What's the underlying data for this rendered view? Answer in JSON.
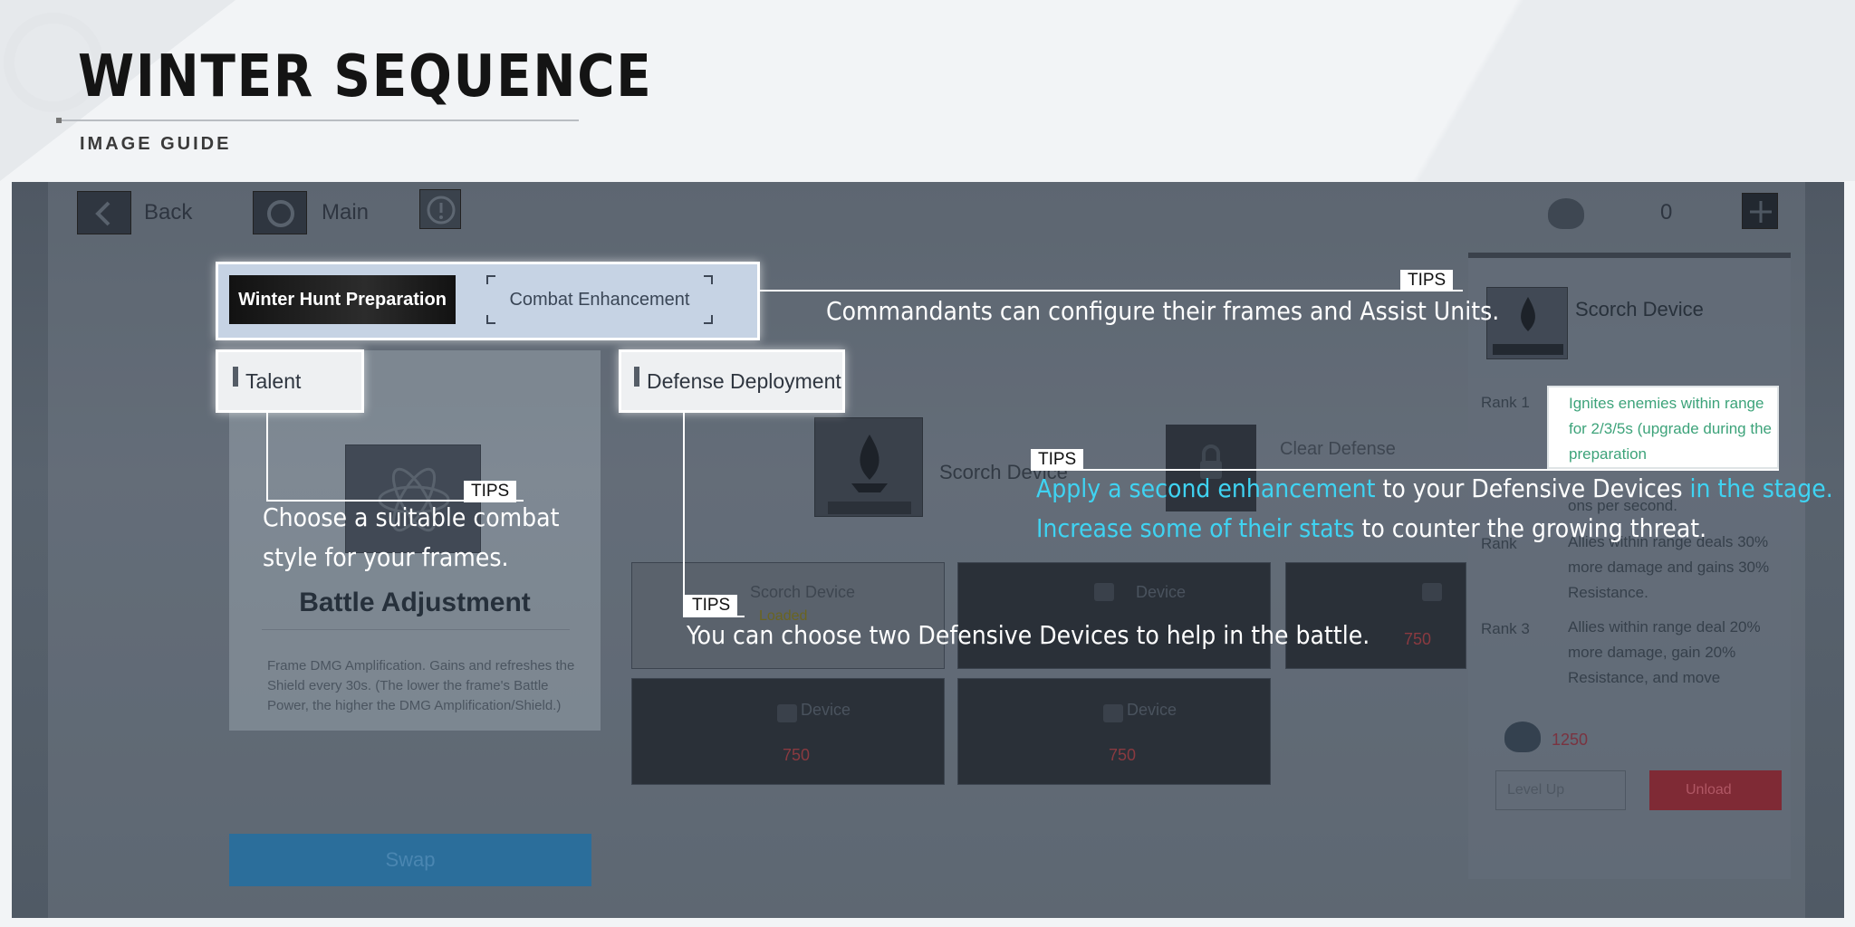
{
  "header": {
    "title": "WINTER SEQUENCE",
    "subtitle": "IMAGE GUIDE"
  },
  "topbar": {
    "back_label": "Back",
    "main_label": "Main",
    "currency_value": "0"
  },
  "tabs": {
    "active": "Winter Hunt Preparation",
    "inactive": "Combat Enhancement"
  },
  "sections": {
    "talent": "Talent",
    "defense": "Defense Deployment"
  },
  "talent_panel": {
    "title": "Battle Adjustment",
    "description": "Frame DMG Amplification. Gains and refreshes the Shield every 30s. (The lower the frame's Battle Power, the higher the DMG Amplification/Shield.)",
    "swap_label": "Swap"
  },
  "defense_center": {
    "selected_name": "Scorch Device",
    "rank_label": "Rank",
    "rank_value": "1",
    "clear_label": "Clear Defense"
  },
  "devices": [
    {
      "name": "Scorch Device",
      "status": "Loaded",
      "cost": ""
    },
    {
      "name": "Device",
      "status": "",
      "cost": ""
    },
    {
      "name": "Device",
      "status": "",
      "cost": "750"
    },
    {
      "name": "Device",
      "status": "",
      "cost": "750"
    },
    {
      "name": "Device",
      "status": "",
      "cost": "750"
    }
  ],
  "right_panel": {
    "title": "Scorch Device",
    "rank_badge": "1",
    "rank1_label": "Rank 1",
    "rank1_text": "Ignites enemies within range for 2/3/5s (upgrade during the preparation",
    "rank1_tail": "ons per second.",
    "rank2_label": "Rank",
    "rank2_text": "Allies within range deals 30% more damage and gains 30% Resistance.",
    "rank3_label": "Rank 3",
    "rank3_text": "Allies within range deal 20% more damage, gain 20% Resistance, and move",
    "cost": "1250",
    "level_up_label": "Level Up",
    "unload_label": "Unload"
  },
  "tips": {
    "tag": "TIPS",
    "tip1": "Commandants can configure their frames and Assist Units.",
    "tip2_line1": "Choose a suitable combat",
    "tip2_line2": "style for your frames.",
    "tip3_h1": "Apply a second enhancement",
    "tip3_t1": " to your Defensive Devices ",
    "tip3_h2": "in the stage.",
    "tip3_h3": "Increase some of their stats",
    "tip3_t2": " to counter the growing threat.",
    "tip4": "You can choose two Defensive Devices to help in the battle."
  },
  "colors": {
    "highlight": "#3fd3f2",
    "green_text": "#3da37a",
    "unload": "#7f2a35"
  }
}
